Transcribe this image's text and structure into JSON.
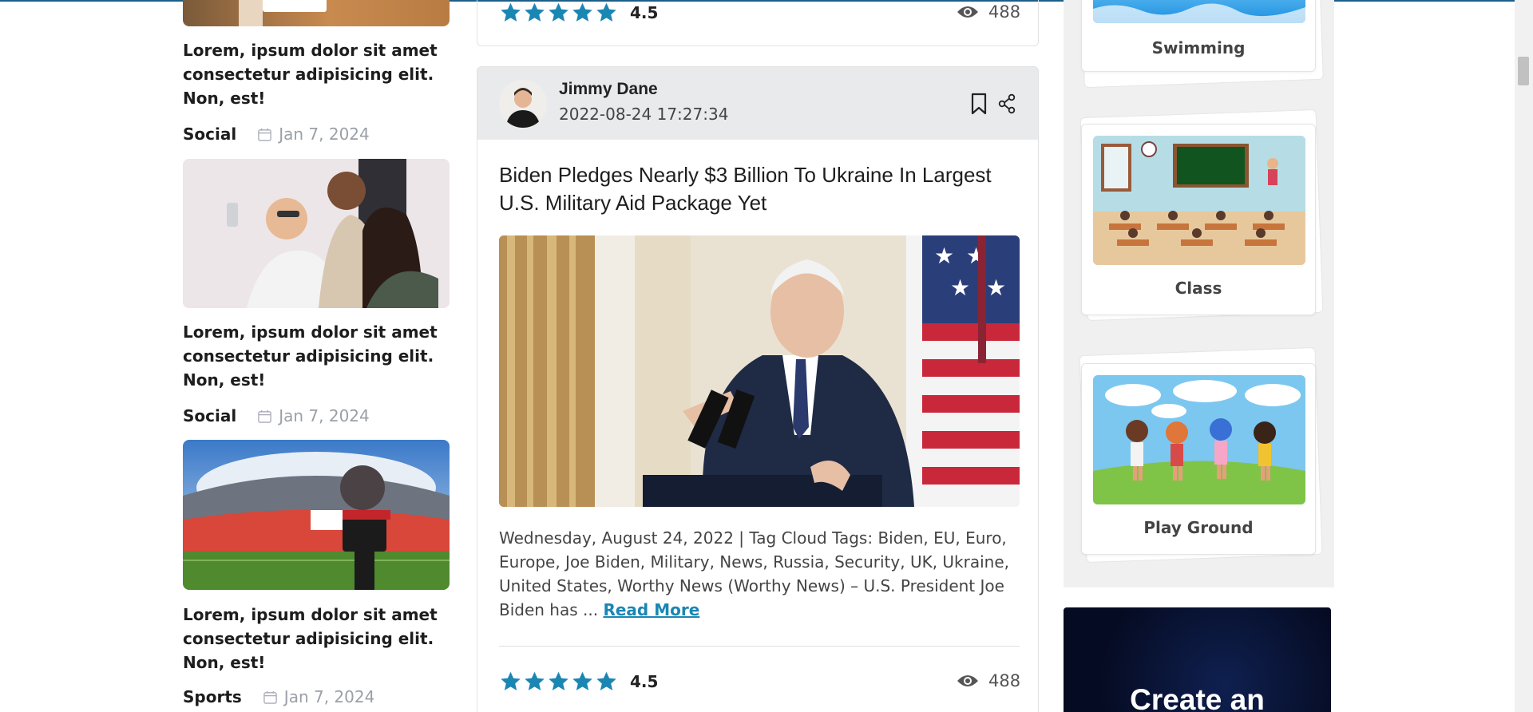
{
  "left_posts": [
    {
      "title": "Lorem, ipsum dolor sit amet consectetur adipisicing elit. Non, est!",
      "category": "Social",
      "date": "Jan 7, 2024",
      "image": "delivery-box-photo"
    },
    {
      "title": "Lorem, ipsum dolor sit amet consectetur adipisicing elit. Non, est!",
      "category": "Social",
      "date": "Jan 7, 2024",
      "image": "friends-selfie-photo"
    },
    {
      "title": "Lorem, ipsum dolor sit amet consectetur adipisicing elit. Non, est!",
      "category": "Sports",
      "date": "Jan 7, 2024",
      "image": "stadium-camera-photo"
    }
  ],
  "top_card": {
    "rating": "4.5",
    "views": "488",
    "stars": 5
  },
  "post": {
    "author": "Jimmy Dane",
    "datetime": "2022-08-24 17:27:34",
    "title": "Biden Pledges Nearly $3 Billion To Ukraine In Largest U.S. Military Aid Package Yet",
    "excerpt": "Wednesday, August 24, 2022 | Tag Cloud Tags: Biden, EU, Euro, Europe, Joe Biden, Military, News, Russia, Security, UK, Ukraine, United States, Worthy News (Worthy News) – U.S. President Joe Biden has ... ",
    "read_more": "Read More",
    "rating": "4.5",
    "views": "488",
    "stars": 5
  },
  "categories": [
    {
      "label": "Swimming"
    },
    {
      "label": "Class"
    },
    {
      "label": "Play Ground"
    }
  ],
  "promo": {
    "text": "Create an"
  },
  "colors": {
    "accent": "#1a86b3",
    "star": "#1a86b3"
  }
}
